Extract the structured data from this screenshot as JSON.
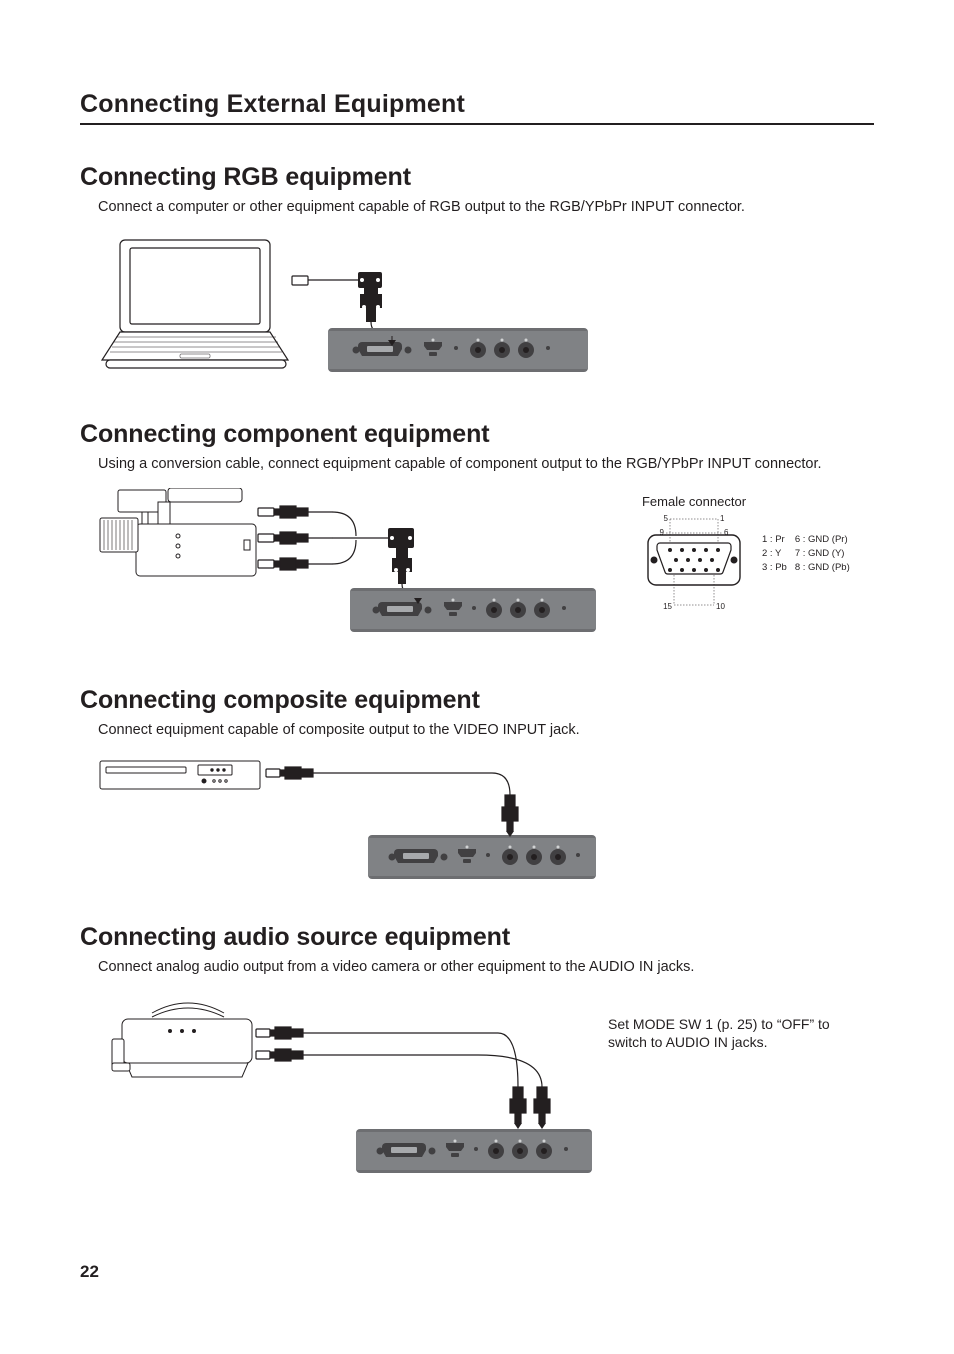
{
  "chapter_title": "Connecting External Equipment",
  "sections": {
    "rgb": {
      "title": "Connecting RGB equipment",
      "body": "Connect a computer or other equipment capable of RGB output to the RGB/YPbPr INPUT connector."
    },
    "component": {
      "title": "Connecting component equipment",
      "body": "Using a conversion cable, connect equipment capable of component output to the RGB/YPbPr INPUT connector.",
      "connector_caption": "Female connector",
      "pin_corners": {
        "tl": "5",
        "tr": "1",
        "ml": "9",
        "mr": "6",
        "bl": "15",
        "br": "10"
      },
      "pins": [
        {
          "n": "1 : Pr",
          "g": "6 : GND (Pr)"
        },
        {
          "n": "2 : Y",
          "g": "7 : GND (Y)"
        },
        {
          "n": "3 : Pb",
          "g": "8 : GND (Pb)"
        }
      ]
    },
    "composite": {
      "title": "Connecting composite equipment",
      "body": "Connect equipment capable of composite output to the VIDEO INPUT jack."
    },
    "audio": {
      "title": "Connecting audio source equipment",
      "body": "Connect analog audio output from a video camera or other equipment to the AUDIO IN jacks.",
      "note": "Set MODE SW 1 (p. 25) to “OFF” to switch to AUDIO IN jacks."
    }
  },
  "page_number": "22"
}
